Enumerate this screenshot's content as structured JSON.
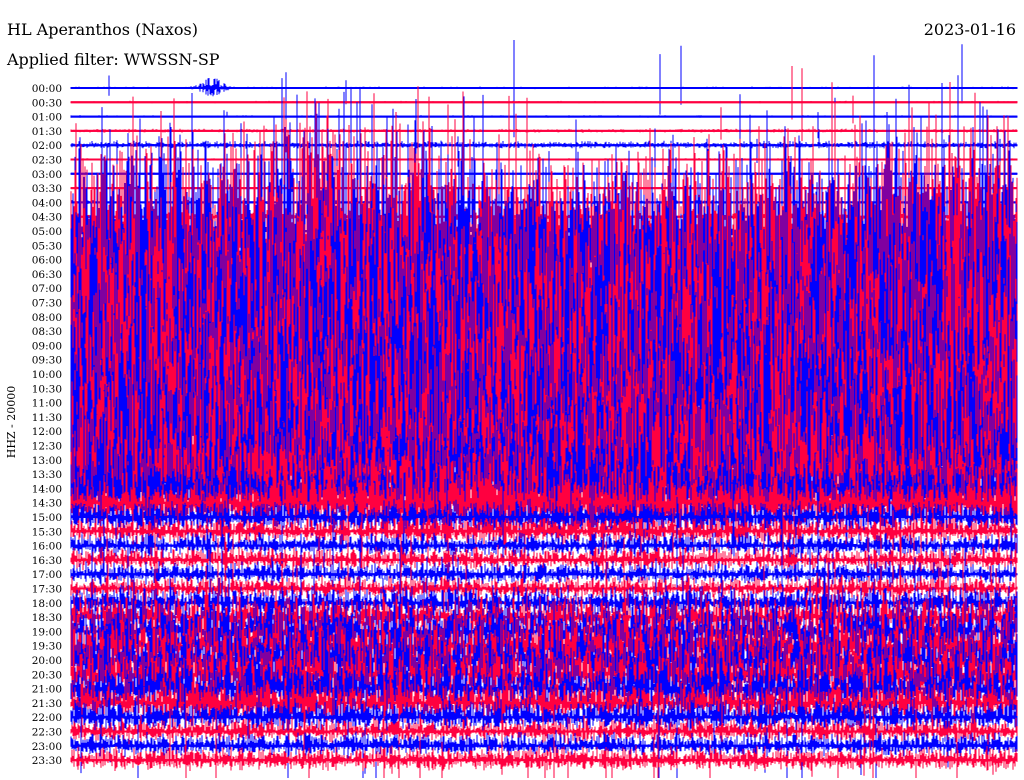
{
  "header": {
    "station": "HL Aperanthos (Naxos)",
    "filter": "Applied filter: WWSSN-SP",
    "date": "2023-01-16"
  },
  "chart_data": {
    "type": "line",
    "title": "HL Aperanthos (Naxos)",
    "subtitle": "Applied filter: WWSSN-SP",
    "date": "2023-01-16",
    "ylabel": "HHZ - 20000",
    "colors": [
      "#0000ff",
      "#ff0040"
    ],
    "rows": [
      {
        "label": "00:00",
        "amp": 1
      },
      {
        "label": "00:30",
        "amp": 1
      },
      {
        "label": "01:00",
        "amp": 1
      },
      {
        "label": "01:30",
        "amp": 1.5
      },
      {
        "label": "02:00",
        "amp": 3
      },
      {
        "label": "02:30",
        "amp": 1
      },
      {
        "label": "03:00",
        "amp": 1
      },
      {
        "label": "03:30",
        "amp": 1
      },
      {
        "label": "04:00",
        "amp": 1.5
      },
      {
        "label": "04:30",
        "amp": 3
      },
      {
        "label": "05:00",
        "amp": 5
      },
      {
        "label": "05:30",
        "amp": 120
      },
      {
        "label": "06:00",
        "amp": 140
      },
      {
        "label": "06:30",
        "amp": 140
      },
      {
        "label": "07:00",
        "amp": 140
      },
      {
        "label": "07:30",
        "amp": 140
      },
      {
        "label": "08:00",
        "amp": 140
      },
      {
        "label": "08:30",
        "amp": 140
      },
      {
        "label": "09:00",
        "amp": 140
      },
      {
        "label": "09:30",
        "amp": 140
      },
      {
        "label": "10:00",
        "amp": 140
      },
      {
        "label": "10:30",
        "amp": 140
      },
      {
        "label": "11:00",
        "amp": 140
      },
      {
        "label": "11:30",
        "amp": 130
      },
      {
        "label": "12:00",
        "amp": 120
      },
      {
        "label": "12:30",
        "amp": 110
      },
      {
        "label": "13:00",
        "amp": 100
      },
      {
        "label": "13:30",
        "amp": 90
      },
      {
        "label": "14:00",
        "amp": 70
      },
      {
        "label": "14:30",
        "amp": 50
      },
      {
        "label": "15:00",
        "amp": 12
      },
      {
        "label": "15:30",
        "amp": 10
      },
      {
        "label": "16:00",
        "amp": 9
      },
      {
        "label": "16:30",
        "amp": 9
      },
      {
        "label": "17:00",
        "amp": 9
      },
      {
        "label": "17:30",
        "amp": 9
      },
      {
        "label": "18:00",
        "amp": 12
      },
      {
        "label": "18:30",
        "amp": 18
      },
      {
        "label": "19:00",
        "amp": 25
      },
      {
        "label": "19:30",
        "amp": 28
      },
      {
        "label": "20:00",
        "amp": 30
      },
      {
        "label": "20:30",
        "amp": 30
      },
      {
        "label": "21:00",
        "amp": 28
      },
      {
        "label": "21:30",
        "amp": 20
      },
      {
        "label": "22:00",
        "amp": 14
      },
      {
        "label": "22:30",
        "amp": 10
      },
      {
        "label": "23:00",
        "amp": 10
      },
      {
        "label": "23:30",
        "amp": 10
      }
    ]
  }
}
